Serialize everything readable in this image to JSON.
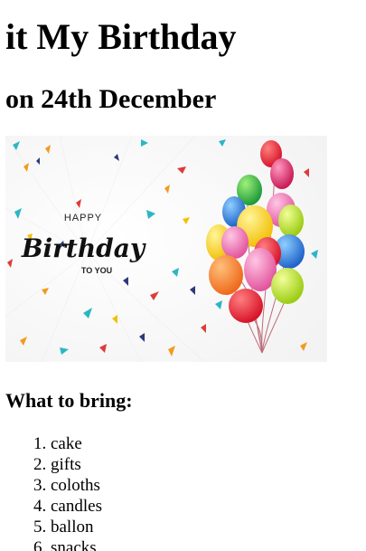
{
  "heading": "it My Birthday",
  "date_heading": "on 24th December",
  "image": {
    "alt": "Happy Birthday to you card",
    "line1": "HAPPY",
    "line2": "Birthday",
    "line3": "TO YOU"
  },
  "bring_heading": "What to bring:",
  "bring_items": [
    "cake",
    "gifts",
    "coloths",
    "candles",
    "ballon",
    "snacks"
  ]
}
